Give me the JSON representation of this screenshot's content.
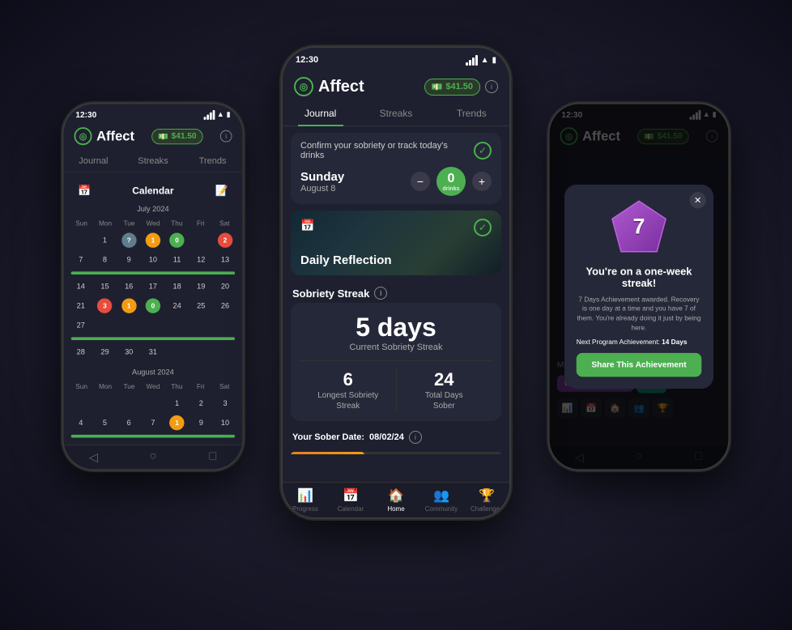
{
  "app": {
    "name": "Affect",
    "balance": "$41.50",
    "time_left": "12:30",
    "time_center": "12:30",
    "time_right": "12:30"
  },
  "tabs": {
    "journal": "Journal",
    "streaks": "Streaks",
    "trends": "Trends"
  },
  "journal": {
    "confirm_header": "Confirm your sobriety or track today's drinks",
    "day_name": "Sunday",
    "day_date": "August 8",
    "drinks_count": "0",
    "drinks_label": "drinks",
    "minus_label": "−",
    "plus_label": "+",
    "reflection_title": "Daily Reflection"
  },
  "streak": {
    "section_label": "Sobriety Streak",
    "days": "5 days",
    "days_label": "Current Sobriety Streak",
    "longest_number": "6",
    "longest_label": "Longest Sobriety\nStreak",
    "total_number": "24",
    "total_label": "Total Days\nSober",
    "sober_date_label": "Your Sober Date:",
    "sober_date": "08/02/24"
  },
  "calendar": {
    "title": "Calendar",
    "month1": "July 2024",
    "month2": "August 2024",
    "day_names": [
      "Sun",
      "Mon",
      "Tue",
      "Wed",
      "Thu",
      "Fri",
      "Sat"
    ]
  },
  "achievement": {
    "badge_number": "7",
    "title": "You're on a one-week streak!",
    "description": "7 Days Achievement awarded. Recovery is one day at a time and you have 7 of them. You're already doing it just by being here.",
    "next_label": "Next Program Achievement:",
    "next_value": "14 Days",
    "share_label": "Share This Achievement"
  },
  "missions": {
    "header": "Missions",
    "weekly_label": "WEEKLY MISSIONS"
  },
  "nav": {
    "progress": "Progress",
    "calendar": "Calendar",
    "home": "Home",
    "community": "Community",
    "challenges": "Challenges"
  },
  "colors": {
    "green": "#4CAF50",
    "orange": "#e67e22",
    "purple": "#8e44ad",
    "teal": "#16a085",
    "red": "#e74c3c",
    "yellow": "#f39c12",
    "accent": "#4CAF50"
  }
}
